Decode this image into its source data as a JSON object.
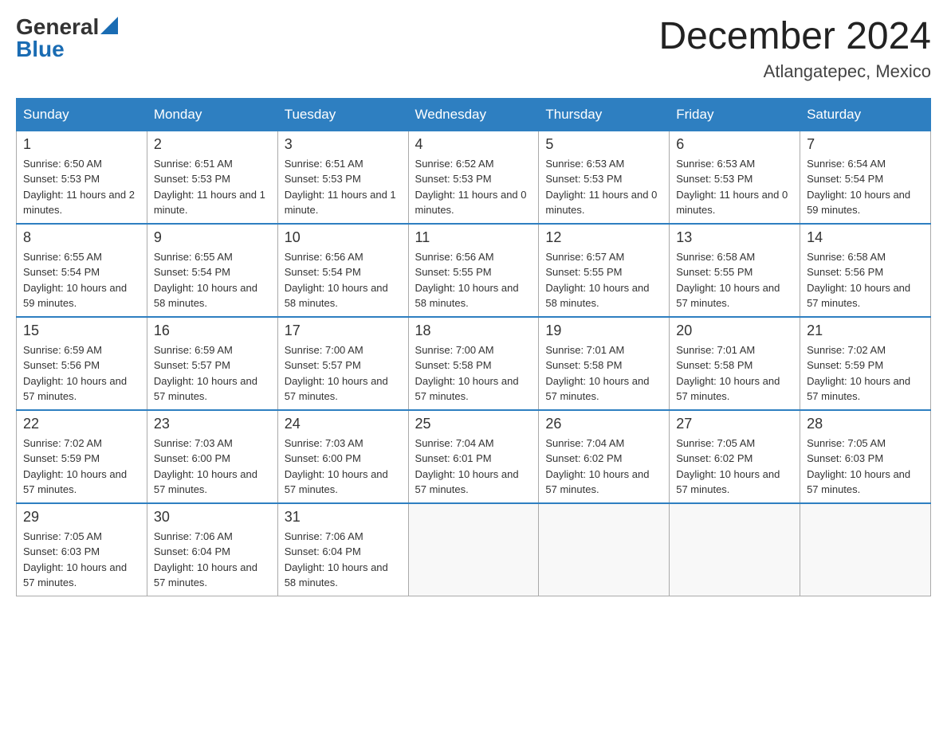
{
  "logo": {
    "general": "General",
    "blue": "Blue"
  },
  "title": "December 2024",
  "location": "Atlangatepec, Mexico",
  "days_of_week": [
    "Sunday",
    "Monday",
    "Tuesday",
    "Wednesday",
    "Thursday",
    "Friday",
    "Saturday"
  ],
  "weeks": [
    [
      {
        "day": "1",
        "sunrise": "6:50 AM",
        "sunset": "5:53 PM",
        "daylight": "11 hours and 2 minutes."
      },
      {
        "day": "2",
        "sunrise": "6:51 AM",
        "sunset": "5:53 PM",
        "daylight": "11 hours and 1 minute."
      },
      {
        "day": "3",
        "sunrise": "6:51 AM",
        "sunset": "5:53 PM",
        "daylight": "11 hours and 1 minute."
      },
      {
        "day": "4",
        "sunrise": "6:52 AM",
        "sunset": "5:53 PM",
        "daylight": "11 hours and 0 minutes."
      },
      {
        "day": "5",
        "sunrise": "6:53 AM",
        "sunset": "5:53 PM",
        "daylight": "11 hours and 0 minutes."
      },
      {
        "day": "6",
        "sunrise": "6:53 AM",
        "sunset": "5:53 PM",
        "daylight": "11 hours and 0 minutes."
      },
      {
        "day": "7",
        "sunrise": "6:54 AM",
        "sunset": "5:54 PM",
        "daylight": "10 hours and 59 minutes."
      }
    ],
    [
      {
        "day": "8",
        "sunrise": "6:55 AM",
        "sunset": "5:54 PM",
        "daylight": "10 hours and 59 minutes."
      },
      {
        "day": "9",
        "sunrise": "6:55 AM",
        "sunset": "5:54 PM",
        "daylight": "10 hours and 58 minutes."
      },
      {
        "day": "10",
        "sunrise": "6:56 AM",
        "sunset": "5:54 PM",
        "daylight": "10 hours and 58 minutes."
      },
      {
        "day": "11",
        "sunrise": "6:56 AM",
        "sunset": "5:55 PM",
        "daylight": "10 hours and 58 minutes."
      },
      {
        "day": "12",
        "sunrise": "6:57 AM",
        "sunset": "5:55 PM",
        "daylight": "10 hours and 58 minutes."
      },
      {
        "day": "13",
        "sunrise": "6:58 AM",
        "sunset": "5:55 PM",
        "daylight": "10 hours and 57 minutes."
      },
      {
        "day": "14",
        "sunrise": "6:58 AM",
        "sunset": "5:56 PM",
        "daylight": "10 hours and 57 minutes."
      }
    ],
    [
      {
        "day": "15",
        "sunrise": "6:59 AM",
        "sunset": "5:56 PM",
        "daylight": "10 hours and 57 minutes."
      },
      {
        "day": "16",
        "sunrise": "6:59 AM",
        "sunset": "5:57 PM",
        "daylight": "10 hours and 57 minutes."
      },
      {
        "day": "17",
        "sunrise": "7:00 AM",
        "sunset": "5:57 PM",
        "daylight": "10 hours and 57 minutes."
      },
      {
        "day": "18",
        "sunrise": "7:00 AM",
        "sunset": "5:58 PM",
        "daylight": "10 hours and 57 minutes."
      },
      {
        "day": "19",
        "sunrise": "7:01 AM",
        "sunset": "5:58 PM",
        "daylight": "10 hours and 57 minutes."
      },
      {
        "day": "20",
        "sunrise": "7:01 AM",
        "sunset": "5:58 PM",
        "daylight": "10 hours and 57 minutes."
      },
      {
        "day": "21",
        "sunrise": "7:02 AM",
        "sunset": "5:59 PM",
        "daylight": "10 hours and 57 minutes."
      }
    ],
    [
      {
        "day": "22",
        "sunrise": "7:02 AM",
        "sunset": "5:59 PM",
        "daylight": "10 hours and 57 minutes."
      },
      {
        "day": "23",
        "sunrise": "7:03 AM",
        "sunset": "6:00 PM",
        "daylight": "10 hours and 57 minutes."
      },
      {
        "day": "24",
        "sunrise": "7:03 AM",
        "sunset": "6:00 PM",
        "daylight": "10 hours and 57 minutes."
      },
      {
        "day": "25",
        "sunrise": "7:04 AM",
        "sunset": "6:01 PM",
        "daylight": "10 hours and 57 minutes."
      },
      {
        "day": "26",
        "sunrise": "7:04 AM",
        "sunset": "6:02 PM",
        "daylight": "10 hours and 57 minutes."
      },
      {
        "day": "27",
        "sunrise": "7:05 AM",
        "sunset": "6:02 PM",
        "daylight": "10 hours and 57 minutes."
      },
      {
        "day": "28",
        "sunrise": "7:05 AM",
        "sunset": "6:03 PM",
        "daylight": "10 hours and 57 minutes."
      }
    ],
    [
      {
        "day": "29",
        "sunrise": "7:05 AM",
        "sunset": "6:03 PM",
        "daylight": "10 hours and 57 minutes."
      },
      {
        "day": "30",
        "sunrise": "7:06 AM",
        "sunset": "6:04 PM",
        "daylight": "10 hours and 57 minutes."
      },
      {
        "day": "31",
        "sunrise": "7:06 AM",
        "sunset": "6:04 PM",
        "daylight": "10 hours and 58 minutes."
      },
      null,
      null,
      null,
      null
    ]
  ]
}
